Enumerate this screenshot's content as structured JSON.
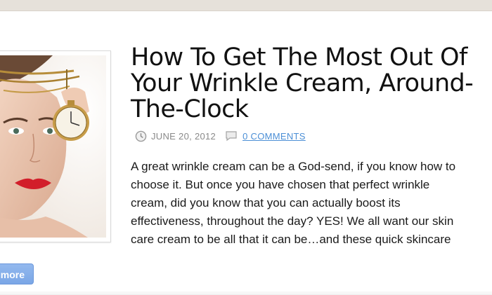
{
  "post": {
    "title": "How To Get The Most Out Of Your Wrinkle Cream, Around-The-Clock",
    "date": "JUNE 20, 2012",
    "comments_label": "0 COMMENTS",
    "excerpt": "A great wrinkle cream can be a God-send, if you know how to\nchoose it.  But once you have chosen that perfect wrinkle\ncream, did you know that you can actually boost its\neffectiveness, throughout the day? YES!  We all want our skin\ncare cream to be all that it can be…and these quick skincare",
    "read_more_label": "more",
    "thumbnail_icon": "woman-with-pocket-watch-photo"
  },
  "icons": {
    "date": "clock-icon",
    "comments": "comment-bubble-icon"
  },
  "colors": {
    "link": "#4c8fd6",
    "button": "#7aa6e6",
    "title": "#111111"
  }
}
